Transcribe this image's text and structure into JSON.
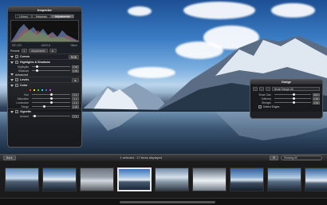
{
  "inspector": {
    "title": "Inspector",
    "tabs": [
      "Library",
      "Metadata",
      "Adjustments"
    ],
    "active_tab": 2,
    "histogram_info": [
      "ISO 100",
      "1/50 f/11",
      "18mm"
    ],
    "presets_label": "Presets",
    "adjustments_btn": "Adjustments",
    "sections": {
      "curves": "Curves",
      "highlights": "Highlights & Shadows",
      "levels": "Levels",
      "color": "Color",
      "vignette": "Vignette",
      "advanced": "Advanced"
    },
    "rows": {
      "highlights": {
        "label": "Highlights",
        "value": "0.00"
      },
      "shadows": {
        "label": "Shadows",
        "value": "0.00"
      },
      "hue": {
        "label": "Hue",
        "value": "0.0"
      },
      "saturation": {
        "label": "Saturation",
        "value": "0.0"
      },
      "luminance": {
        "label": "Luminance",
        "value": "0.0"
      },
      "range": {
        "label": "Range",
        "value": "1.00"
      },
      "amount": {
        "label": "Amount",
        "value": "0.0"
      }
    },
    "reset_label": "RGB",
    "swatch_colors": [
      "#e03a3a",
      "#e8e23a",
      "#4ac04a",
      "#3ad0d0",
      "#4a6ae0",
      "#c04ad0"
    ]
  },
  "brush": {
    "title": "Dodge",
    "select_label": "Brush Range: All",
    "rows": [
      {
        "label": "Brush Size",
        "value": "50.0"
      },
      {
        "label": "Softness",
        "value": "0.50"
      },
      {
        "label": "Strength",
        "value": "0.50"
      }
    ],
    "detect_label": "Detect Edges"
  },
  "browser": {
    "back_btn": "Back",
    "status": "1 selected - 17 items displayed",
    "filter_label": "Showing All"
  },
  "colors": {
    "accent": "#5b8fd6",
    "hud_bg": "#18181a"
  }
}
